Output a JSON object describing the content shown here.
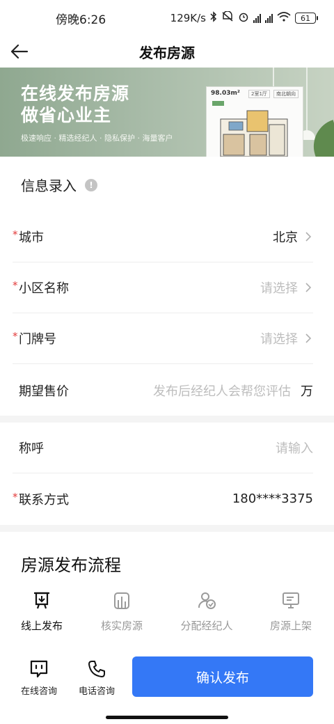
{
  "status": {
    "time": "傍晚6:26",
    "speed": "129K/s",
    "battery": "61"
  },
  "nav": {
    "title": "发布房源"
  },
  "banner": {
    "headline_1": "在线发布房源",
    "headline_2": "做省心业主",
    "subtitle": "极速响应 · 精选经纪人 · 隐私保护 · 海量客户",
    "card_area": "98.03m²",
    "card_layout": "2室1厅",
    "card_orient": "南北朝向"
  },
  "info_section": {
    "title": "信息录入",
    "info_icon": "!"
  },
  "form": {
    "city": {
      "label": "城市",
      "value": "北京"
    },
    "community": {
      "label": "小区名称",
      "placeholder": "请选择"
    },
    "door": {
      "label": "门牌号",
      "placeholder": "请选择"
    },
    "price": {
      "label": "期望售价",
      "placeholder": "发布后经纪人会帮您评估",
      "unit": "万"
    },
    "name": {
      "label": "称呼",
      "placeholder": "请输入"
    },
    "contact": {
      "label": "联系方式",
      "value": "180****3375"
    }
  },
  "process": {
    "title": "房源发布流程",
    "steps": [
      {
        "label": "线上发布",
        "icon": "publish-icon"
      },
      {
        "label": "核实房源",
        "icon": "verify-building-icon"
      },
      {
        "label": "分配经纪人",
        "icon": "assign-agent-icon"
      },
      {
        "label": "房源上架",
        "icon": "listing-monitor-icon"
      }
    ]
  },
  "bottom": {
    "online_label": "在线咨询",
    "phone_label": "电话咨询",
    "confirm_label": "确认发布"
  },
  "colors": {
    "primary": "#3478f6",
    "required": "#e23b3b",
    "placeholder": "#bdbdbd"
  }
}
